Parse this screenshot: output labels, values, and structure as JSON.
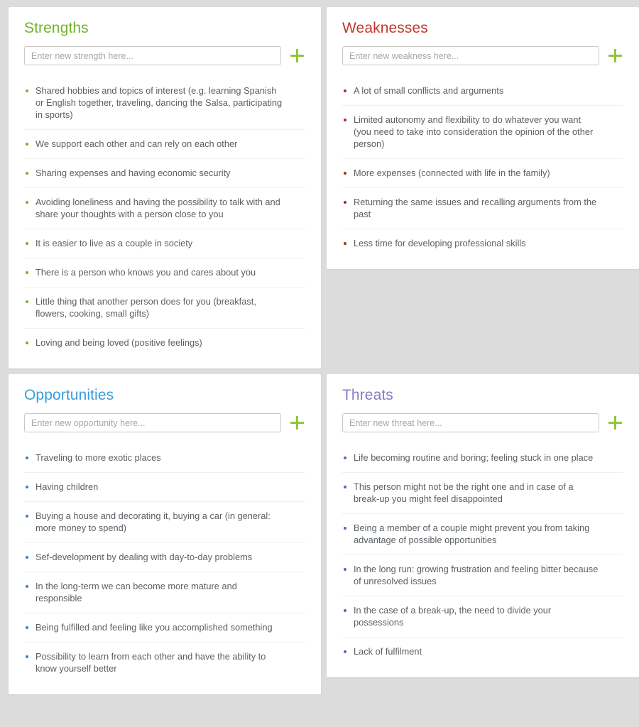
{
  "page": {
    "background_color": "#dcdcdc",
    "layout": "2x2 SWOT grid"
  },
  "colors": {
    "strengths_accent": "#6fb22e",
    "weaknesses_accent": "#c0392b",
    "opportunities_accent": "#3a9bdc",
    "threats_accent": "#8878c8",
    "add_button": "#8cc63e",
    "body_text": "#5a5f63",
    "card_background": "#ffffff"
  },
  "quadrants": {
    "strengths": {
      "title": "Strengths",
      "input_value": "",
      "input_placeholder": "Enter new strength here...",
      "add_label": "+",
      "items": [
        "Shared hobbies and topics of interest (e.g. learning Spanish or English together, traveling, dancing the Salsa, participating in sports)",
        "We support each other and can rely on each other",
        "Sharing expenses and having economic security",
        "Avoiding loneliness and having the possibility to talk with and share your thoughts with a person close to you",
        "It is easier to live as a couple in society",
        "There is a person who knows you and cares about you",
        "Little thing that another person does for you (breakfast, flowers, cooking, small gifts)",
        "Loving and being loved (positive feelings)"
      ]
    },
    "weaknesses": {
      "title": "Weaknesses",
      "input_value": "",
      "input_placeholder": "Enter new weakness here...",
      "add_label": "+",
      "items": [
        "A lot of small conflicts and arguments",
        "Limited autonomy and flexibility to do whatever you want (you need to take into consideration the opinion of the other person)",
        "More expenses (connected with life in the family)",
        "Returning the same issues and recalling arguments from the past",
        "Less time for developing professional skills"
      ]
    },
    "opportunities": {
      "title": "Opportunities",
      "input_value": "",
      "input_placeholder": "Enter new opportunity here...",
      "add_label": "+",
      "items": [
        "Traveling to more exotic places",
        "Having children",
        "Buying a house and decorating it, buying a car (in general: more money to spend)",
        "Sef-development by dealing with day-to-day problems",
        "In the long-term we can become more mature and responsible",
        "Being fulfilled and feeling like you accomplished something",
        "Possibility to learn from each other and have the ability to know yourself better"
      ]
    },
    "threats": {
      "title": "Threats",
      "input_value": "",
      "input_placeholder": "Enter new threat here...",
      "add_label": "+",
      "items": [
        "Life becoming routine and boring; feeling stuck in one place",
        "This person might not be the right one and in case of a break-up you might feel disappointed",
        "Being a member of a couple might prevent you from taking advantage of possible opportunities",
        "In the long run: growing frustration and feeling bitter because of unresolved issues",
        "In the case of a break-up, the need to divide your possessions",
        "Lack of fulfilment"
      ]
    }
  }
}
